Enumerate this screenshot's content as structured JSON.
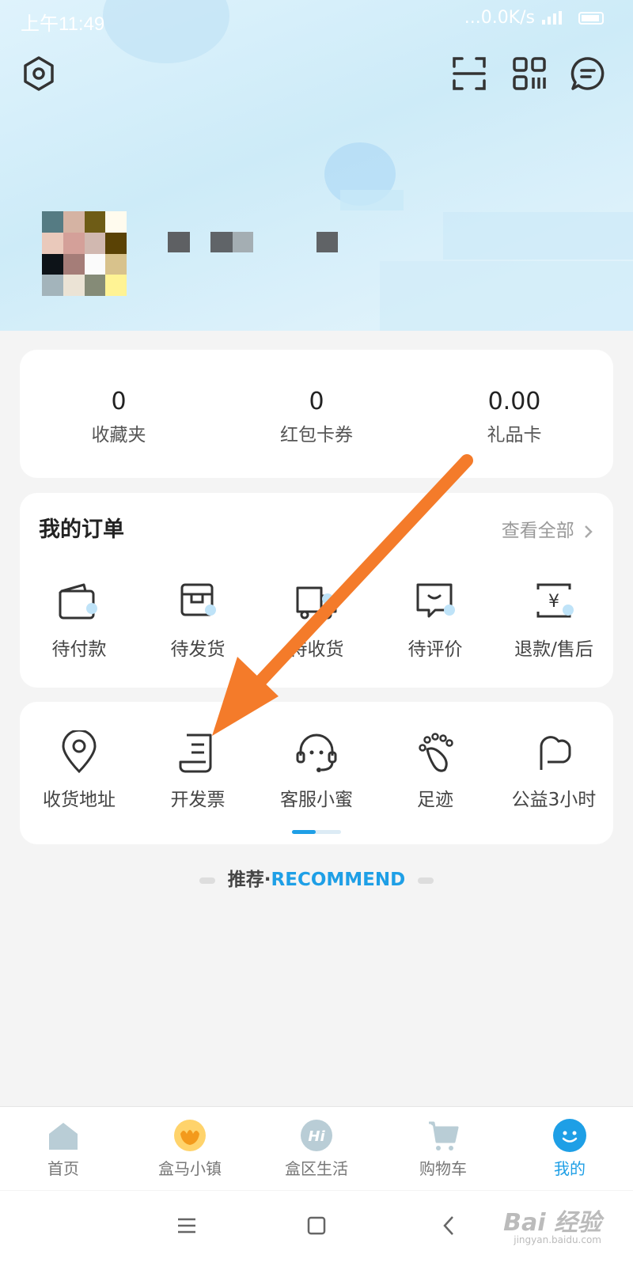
{
  "status_bar": {
    "time": "上午11:49",
    "net": "...0.0K/s"
  },
  "header_icons": [
    "settings-icon",
    "scan-icon",
    "qr-code-icon",
    "message-icon"
  ],
  "stats": [
    {
      "value": "0",
      "label": "收藏夹"
    },
    {
      "value": "0",
      "label": "红包卡券"
    },
    {
      "value": "0.00",
      "label": "礼品卡"
    }
  ],
  "orders": {
    "title": "我的订单",
    "view_all": "查看全部",
    "items": [
      {
        "label": "待付款",
        "icon": "wallet-icon"
      },
      {
        "label": "待发货",
        "icon": "box-icon"
      },
      {
        "label": "待收货",
        "icon": "truck-icon"
      },
      {
        "label": "待评价",
        "icon": "comment-icon"
      },
      {
        "label": "退款/售后",
        "icon": "refund-icon"
      }
    ]
  },
  "tools": {
    "items": [
      {
        "label": "收货地址",
        "icon": "location-icon"
      },
      {
        "label": "开发票",
        "icon": "invoice-icon"
      },
      {
        "label": "客服小蜜",
        "icon": "headset-icon"
      },
      {
        "label": "足迹",
        "icon": "footprint-icon"
      },
      {
        "label": "公益3小时",
        "icon": "charity-icon"
      }
    ],
    "page_indicator": {
      "current": 1,
      "total": 2
    }
  },
  "recommend": {
    "prefix": "推荐·",
    "suffix": "RECOMMEND"
  },
  "tabbar": [
    {
      "label": "首页",
      "icon": "home-icon",
      "active": false
    },
    {
      "label": "盒马小镇",
      "icon": "town-icon",
      "active": false
    },
    {
      "label": "盒区生活",
      "icon": "hi-icon",
      "active": false
    },
    {
      "label": "购物车",
      "icon": "cart-icon",
      "active": false
    },
    {
      "label": "我的",
      "icon": "profile-icon",
      "active": true
    }
  ],
  "watermark": {
    "main": "Bai 经验",
    "sub": "jingyan.baidu.com"
  },
  "colors": {
    "accent": "#1e9fe6",
    "arrow": "#f47b2a",
    "header_bg": "#d6eefa"
  }
}
